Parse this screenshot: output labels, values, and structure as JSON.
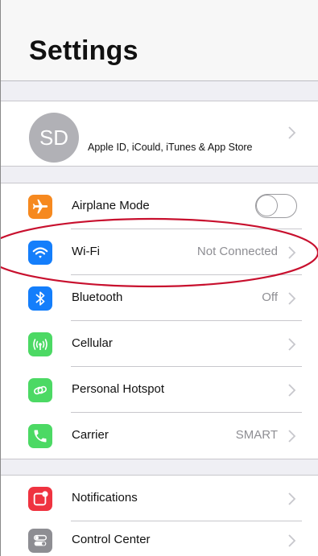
{
  "header": {
    "title": "Settings"
  },
  "account": {
    "avatar_initials": "SD",
    "label": "Apple ID, iCould, iTunes & App Store",
    "chevron_icon": "chevron-right-icon"
  },
  "connectivity": [
    {
      "label": "Airplane Mode",
      "icon": "airplane-icon",
      "color": "#f6891f",
      "control": "toggle",
      "on": false
    },
    {
      "label": "Wi-Fi",
      "value": "Not Connected",
      "icon": "wifi-icon",
      "color": "#147efb",
      "control": "chevron"
    },
    {
      "label": "Bluetooth",
      "value": "Off",
      "icon": "bluetooth-icon",
      "color": "#147efb",
      "control": "chevron"
    },
    {
      "label": "Cellular",
      "icon": "cellular-icon",
      "color": "#4cd964",
      "control": "chevron"
    },
    {
      "label": "Personal Hotspot",
      "icon": "hotspot-icon",
      "color": "#4cd964",
      "control": "chevron"
    },
    {
      "label": "Carrier",
      "value": "SMART",
      "icon": "phone-icon",
      "color": "#4cd964",
      "control": "chevron"
    }
  ],
  "system": [
    {
      "label": "Notifications",
      "icon": "notifications-icon",
      "color": "#ef3340",
      "control": "chevron"
    },
    {
      "label": "Control Center",
      "icon": "control-center-icon",
      "color": "#8e8e93",
      "control": "chevron"
    }
  ],
  "annotation": {
    "color": "#c8102e",
    "target": "Wi-Fi"
  }
}
